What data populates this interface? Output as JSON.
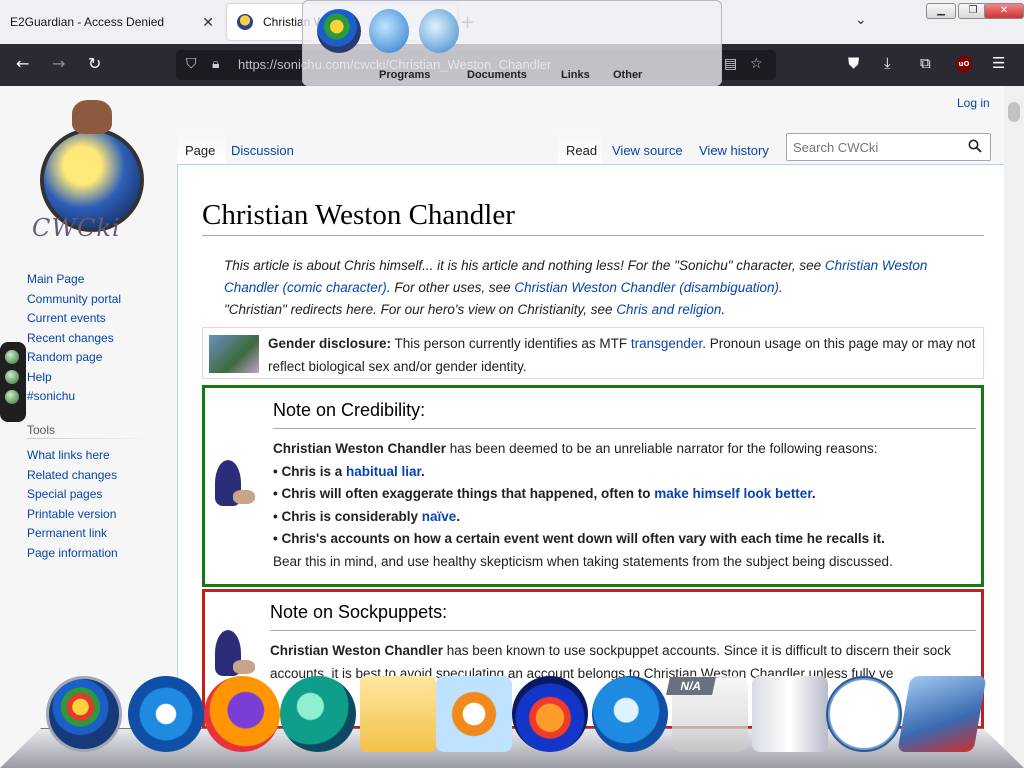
{
  "browser": {
    "tabs": [
      {
        "title": "E2Guardian - Access Denied",
        "active": false
      },
      {
        "title": "Christian W",
        "active": true
      }
    ],
    "new_tab_symbol": "+",
    "url": "https://sonichu.com/cwcki/Christian_Weston_Chandler",
    "extension_badge": "uO"
  },
  "launcher": {
    "labels": [
      "Programs",
      "Documents",
      "Links",
      "Other"
    ]
  },
  "wiki": {
    "logo_text": "CWCki",
    "login": "Log in",
    "page_tabs": [
      "Page",
      "Discussion"
    ],
    "view_tabs": [
      "Read",
      "View source",
      "View history"
    ],
    "search_placeholder": "Search CWCki",
    "navigation": [
      "Main Page",
      "Community portal",
      "Current events",
      "Recent changes",
      "Random page",
      "Help",
      "#sonichu"
    ],
    "tools_heading": "Tools",
    "tools": [
      "What links here",
      "Related changes",
      "Special pages",
      "Printable version",
      "Permanent link",
      "Page information"
    ],
    "title": "Christian Weston Chandler",
    "hatnote": {
      "line1_a": "This article is about Chris himself... it is his article and nothing less! For the \"Sonichu\" character, see ",
      "line1_link": "Christian Weston Chandler (comic character)",
      "line1_b": ". For other uses, see ",
      "line1_link2": "Christian Weston Chandler (disambiguation)",
      "line1_c": ".",
      "line2_a": "\"Christian\" redirects here. For our hero's view on Christianity, see ",
      "line2_link": "Chris and religion",
      "line2_b": "."
    },
    "gender": {
      "label": "Gender disclosure:",
      "text_a": " This person currently identifies as MTF ",
      "link": "transgender",
      "text_b": ". Pronoun usage on this page may or may not reflect biological sex and/or gender identity."
    },
    "credibility": {
      "heading": "Note on Credibility:",
      "intro_bold": "Christian Weston Chandler",
      "intro_rest": " has been deemed to be an unreliable narrator for the following reasons:",
      "b1_a": "• Chris is a ",
      "b1_link": "habitual liar",
      "b1_b": ".",
      "b2_a": "• Chris will often exaggerate things that happened, often to ",
      "b2_link": "make himself look better",
      "b2_b": ".",
      "b3_a": "• Chris is considerably ",
      "b3_link": "naïve",
      "b3_b": ".",
      "b4": "• Chris's accounts on how a certain event went down will often vary with each time he recalls it.",
      "outro": "Bear this in mind, and use healthy skepticism when taking statements from the subject being discussed."
    },
    "sockpuppets": {
      "heading": "Note on Sockpuppets:",
      "bold": "Christian Weston Chandler",
      "text": " has been known to use sockpuppet accounts. Since it is difficult to discern their sock accounts, it is best to avoid speculating an account belongs to Christian Weston Chandler unless fully ve"
    }
  },
  "dock": {
    "items": [
      "windows-start",
      "internet-explorer",
      "firefox",
      "edge",
      "file-explorer",
      "media-player",
      "audacity",
      "windows-live",
      "na-app",
      "recycle-bin",
      "clock",
      "projector-app"
    ],
    "na_label": "N/A"
  }
}
